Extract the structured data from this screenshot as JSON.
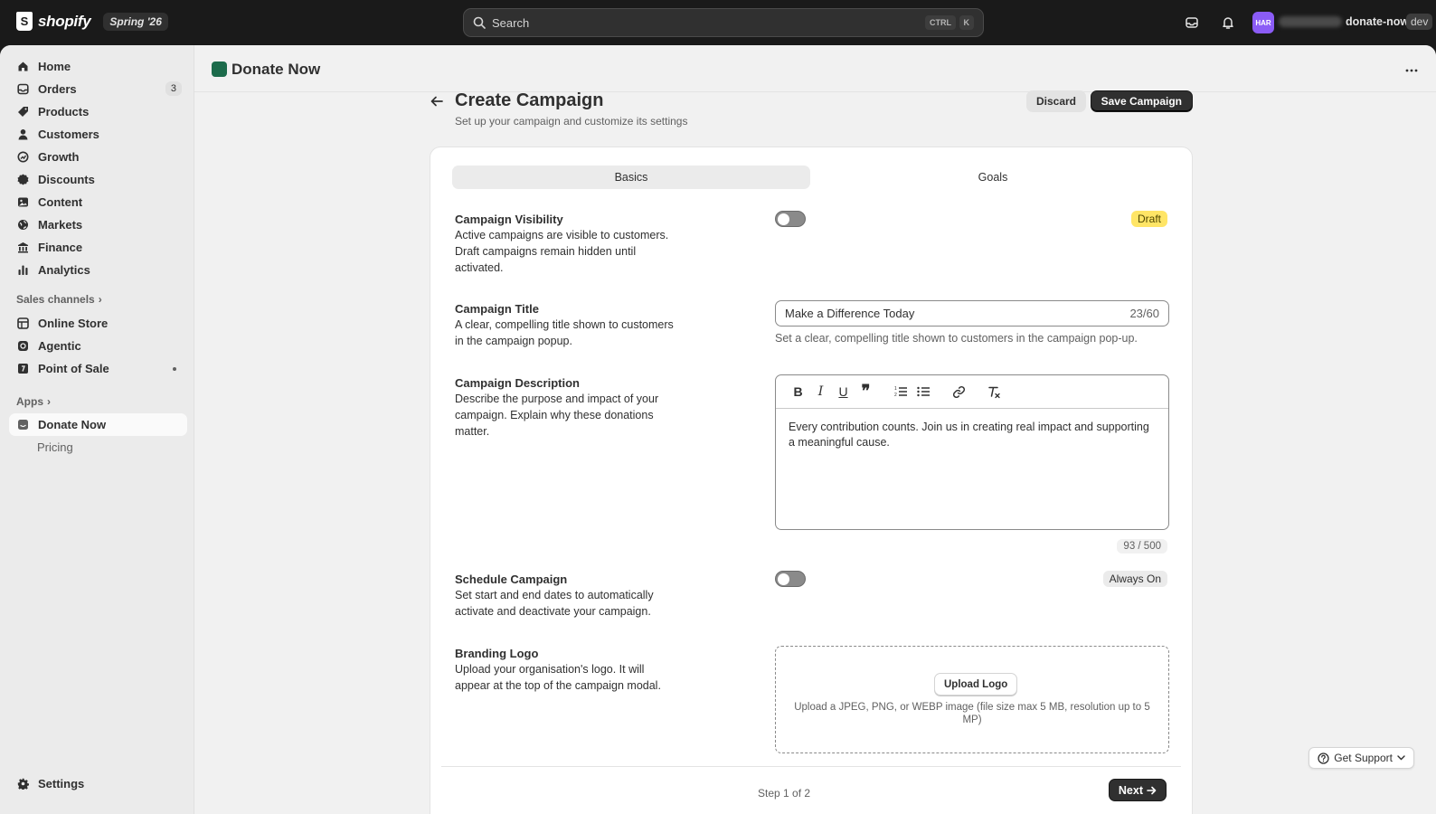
{
  "topbar": {
    "brand": "shopify",
    "edition_badge": "Spring '26",
    "search_placeholder": "Search",
    "kbd_ctrl": "CTRL",
    "kbd_k": "K",
    "avatar_initials": "HAR",
    "store_name": "donate-now",
    "env_badge": "dev"
  },
  "sidebar": {
    "items": [
      {
        "label": "Home",
        "icon": "home-icon"
      },
      {
        "label": "Orders",
        "icon": "orders-icon",
        "badge": "3"
      },
      {
        "label": "Products",
        "icon": "tag-icon"
      },
      {
        "label": "Customers",
        "icon": "person-icon"
      },
      {
        "label": "Growth",
        "icon": "growth-icon"
      },
      {
        "label": "Discounts",
        "icon": "discount-icon"
      },
      {
        "label": "Content",
        "icon": "content-icon"
      },
      {
        "label": "Markets",
        "icon": "globe-icon"
      },
      {
        "label": "Finance",
        "icon": "bank-icon"
      },
      {
        "label": "Analytics",
        "icon": "chart-icon"
      }
    ],
    "sales_channels_label": "Sales channels",
    "sales_channels": [
      {
        "label": "Online Store",
        "icon": "store-icon"
      },
      {
        "label": "Agentic",
        "icon": "agentic-icon"
      },
      {
        "label": "Point of Sale",
        "icon": "pos-icon"
      }
    ],
    "apps_label": "Apps",
    "apps": [
      {
        "label": "Donate Now"
      },
      {
        "label": "Pricing"
      }
    ],
    "settings_label": "Settings"
  },
  "app_header": {
    "title": "Donate Now"
  },
  "page": {
    "title": "Create Campaign",
    "subtitle": "Set up your campaign and customize its settings",
    "discard_label": "Discard",
    "save_label": "Save Campaign"
  },
  "tabs": {
    "basics": "Basics",
    "goals": "Goals"
  },
  "visibility": {
    "title": "Campaign Visibility",
    "description": "Active campaigns are visible to customers. Draft campaigns remain hidden until activated.",
    "status_badge": "Draft"
  },
  "campaign_title": {
    "title": "Campaign Title",
    "description": "A clear, compelling title shown to customers in the campaign popup.",
    "value": "Make a Difference Today",
    "count": "23/60",
    "help": "Set a clear, compelling title shown to customers in the campaign pop-up."
  },
  "campaign_description": {
    "title": "Campaign Description",
    "description": "Describe the purpose and impact of your campaign. Explain why these donations matter.",
    "body": "Every contribution counts. Join us in creating real impact and supporting a meaningful cause.",
    "count": "93 / 500"
  },
  "schedule": {
    "title": "Schedule Campaign",
    "description": "Set start and end dates to automatically activate and deactivate your campaign.",
    "status_badge": "Always On"
  },
  "branding": {
    "title": "Branding Logo",
    "description": "Upload your organisation's logo. It will appear at the top of the campaign modal.",
    "upload_label": "Upload Logo",
    "upload_hint": "Upload a JPEG, PNG, or WEBP image (file size max 5 MB, resolution up to 5 MP)"
  },
  "footer": {
    "step": "Step 1 of 2",
    "next_label": "Next"
  },
  "support": {
    "label": "Get Support"
  }
}
